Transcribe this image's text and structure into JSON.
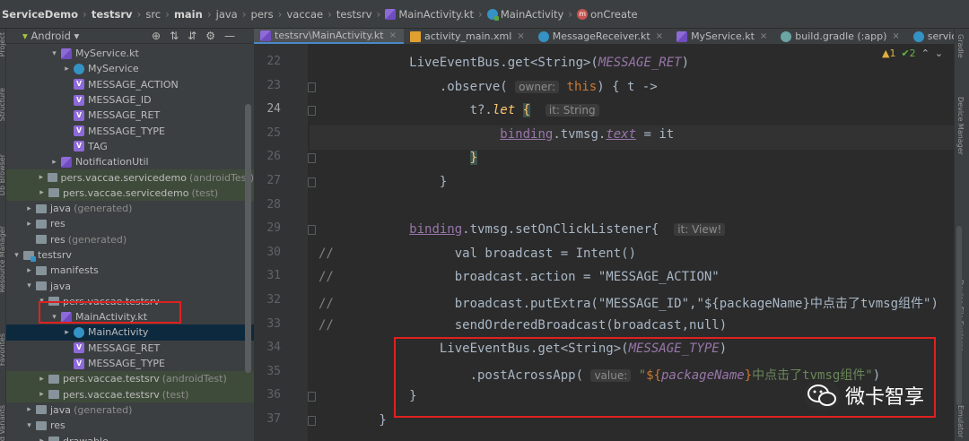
{
  "breadcrumb": [
    "ServiceDemo",
    "testsrv",
    "src",
    "main",
    "java",
    "pers",
    "vaccae",
    "testsrv",
    "MainActivity.kt",
    "MainActivity",
    "onCreate"
  ],
  "left_strip_labels": [
    "Project",
    "Structure",
    "Db Browser",
    "Resource Manager",
    "Favorites",
    "Build Variants"
  ],
  "right_strip_labels": [
    "Gradle",
    "Device Manager",
    "Device File Explorer",
    "Emulator"
  ],
  "project": {
    "view": "Android",
    "tree": [
      {
        "indent": 4,
        "arrow": "▾",
        "icon": "ktf",
        "label": "MyService.kt",
        "suffix": "",
        "style": ""
      },
      {
        "indent": 5,
        "arrow": "▸",
        "icon": "cls",
        "label": "MyService",
        "suffix": "",
        "style": ""
      },
      {
        "indent": 5,
        "arrow": "",
        "icon": "v",
        "label": "MESSAGE_ACTION",
        "suffix": "",
        "style": ""
      },
      {
        "indent": 5,
        "arrow": "",
        "icon": "v",
        "label": "MESSAGE_ID",
        "suffix": "",
        "style": ""
      },
      {
        "indent": 5,
        "arrow": "",
        "icon": "v",
        "label": "MESSAGE_RET",
        "suffix": "",
        "style": ""
      },
      {
        "indent": 5,
        "arrow": "",
        "icon": "v",
        "label": "MESSAGE_TYPE",
        "suffix": "",
        "style": ""
      },
      {
        "indent": 5,
        "arrow": "",
        "icon": "v",
        "label": "TAG",
        "suffix": "",
        "style": ""
      },
      {
        "indent": 4,
        "arrow": "▸",
        "icon": "ktf",
        "label": "NotificationUtil",
        "suffix": "",
        "style": ""
      },
      {
        "indent": 3,
        "arrow": "▸",
        "icon": "folder",
        "label": "pers.vaccae.servicedemo",
        "suffix": "(androidTest)",
        "style": "green"
      },
      {
        "indent": 3,
        "arrow": "▸",
        "icon": "folder",
        "label": "pers.vaccae.servicedemo",
        "suffix": "(test)",
        "style": "green"
      },
      {
        "indent": 2,
        "arrow": "▸",
        "icon": "folder",
        "label": "java",
        "suffix": "(generated)",
        "style": ""
      },
      {
        "indent": 2,
        "arrow": "▸",
        "icon": "folder",
        "label": "res",
        "suffix": "",
        "style": ""
      },
      {
        "indent": 2,
        "arrow": "",
        "icon": "folder",
        "label": "res",
        "suffix": "(generated)",
        "style": ""
      },
      {
        "indent": 1,
        "arrow": "▾",
        "icon": "mod",
        "label": "testsrv",
        "suffix": "",
        "style": ""
      },
      {
        "indent": 2,
        "arrow": "▸",
        "icon": "folder",
        "label": "manifests",
        "suffix": "",
        "style": ""
      },
      {
        "indent": 2,
        "arrow": "▾",
        "icon": "folder",
        "label": "java",
        "suffix": "",
        "style": ""
      },
      {
        "indent": 3,
        "arrow": "▾",
        "icon": "folder",
        "label": "pers.vaccae.testsrv",
        "suffix": "",
        "style": ""
      },
      {
        "indent": 4,
        "arrow": "▾",
        "icon": "ktf",
        "label": "MainActivity.kt",
        "suffix": "",
        "style": ""
      },
      {
        "indent": 5,
        "arrow": "▸",
        "icon": "cls",
        "label": "MainActivity",
        "suffix": "",
        "style": "sel"
      },
      {
        "indent": 5,
        "arrow": "",
        "icon": "v",
        "label": "MESSAGE_RET",
        "suffix": "",
        "style": ""
      },
      {
        "indent": 5,
        "arrow": "",
        "icon": "v",
        "label": "MESSAGE_TYPE",
        "suffix": "",
        "style": ""
      },
      {
        "indent": 3,
        "arrow": "▸",
        "icon": "folder",
        "label": "pers.vaccae.testsrv",
        "suffix": "(androidTest)",
        "style": "green"
      },
      {
        "indent": 3,
        "arrow": "▸",
        "icon": "folder",
        "label": "pers.vaccae.testsrv",
        "suffix": "(test)",
        "style": "green"
      },
      {
        "indent": 2,
        "arrow": "▸",
        "icon": "folder",
        "label": "java",
        "suffix": "(generated)",
        "style": ""
      },
      {
        "indent": 2,
        "arrow": "▾",
        "icon": "folder",
        "label": "res",
        "suffix": "",
        "style": ""
      },
      {
        "indent": 3,
        "arrow": "▸",
        "icon": "folder",
        "label": "drawable",
        "suffix": "",
        "style": ""
      }
    ]
  },
  "tabs": [
    {
      "label": "testsrv\\MainActivity.kt",
      "icon": "ktf",
      "active": true,
      "close": "×"
    },
    {
      "label": "activity_main.xml",
      "icon": "xml",
      "active": false,
      "close": "×"
    },
    {
      "label": "MessageReceiver.kt",
      "icon": "cls",
      "active": false,
      "close": "×"
    },
    {
      "label": "MyService.kt",
      "icon": "ktf",
      "active": false,
      "close": "×"
    },
    {
      "label": "build.gradle (:app)",
      "icon": "gr",
      "active": false,
      "close": "×"
    },
    {
      "label": "servicedemo\\M",
      "icon": "cls",
      "active": false,
      "close": ""
    }
  ],
  "inspection": {
    "warnings": "▲1",
    "ok": "✔2",
    "up": "⌃",
    "down": "⌄"
  },
  "editor": {
    "current_line": 24,
    "lines": [
      {
        "n": "22",
        "fold": false,
        "html": "            LiveEventBus.get&lt;String&gt;(<span class='purp italic'>MESSAGE_RET</span>)"
      },
      {
        "n": "23",
        "fold": true,
        "html": "                .observe( <span class='hint'>owner:</span> <span class='kw'>this</span>) { t -&gt;"
      },
      {
        "n": "24",
        "fold": true,
        "html": "                    t?.<span class='fn italic'>let</span> <span class='fn brace'>{</span>  <span class='hint'>it: String</span>"
      },
      {
        "n": "25",
        "fold": false,
        "html": "                        <span class='purp und'>binding</span>.tvmsg.<span class='purp italic und'>text</span> = it"
      },
      {
        "n": "26",
        "fold": true,
        "html": "                    <span class='fn brace'>}</span>"
      },
      {
        "n": "27",
        "fold": true,
        "html": "                }"
      },
      {
        "n": "28",
        "fold": false,
        "html": ""
      },
      {
        "n": "29",
        "fold": true,
        "html": "            <span class='purp und'>binding</span>.tvmsg.setOnClickListener{  <span class='hint'>it: View!</span>"
      },
      {
        "n": "30",
        "fold": false,
        "html": "<span class='cmt'>//</span>                val broadcast = Intent()"
      },
      {
        "n": "31",
        "fold": false,
        "html": "<span class='cmt'>//</span>                broadcast.action = \"MESSAGE_ACTION\""
      },
      {
        "n": "32",
        "fold": false,
        "html": "<span class='cmt'>//</span>                broadcast.putExtra(\"MESSAGE_ID\",\"${packageName}中点击了tvmsg组件\")"
      },
      {
        "n": "33",
        "fold": false,
        "html": "<span class='cmt'>//</span>                sendOrderedBroadcast(broadcast,null)"
      },
      {
        "n": "34",
        "fold": false,
        "html": "                LiveEventBus.get&lt;String&gt;(<span class='purp italic'>MESSAGE_TYPE</span>)"
      },
      {
        "n": "35",
        "fold": false,
        "html": "                    .postAcrossApp( <span class='hint'>value:</span> <span class='str'>\"<span class='kw'>${</span><span class='purp italic'>packageName</span><span class='kw'>}</span>中点击了tvmsg组件\"</span>)"
      },
      {
        "n": "36",
        "fold": true,
        "html": "            }"
      },
      {
        "n": "37",
        "fold": true,
        "html": "        }"
      }
    ]
  },
  "watermark": "微卡智享",
  "colors": {
    "accent": "#4a88c7",
    "highlight_box": "#e02020",
    "background": "#2b2b2b"
  }
}
